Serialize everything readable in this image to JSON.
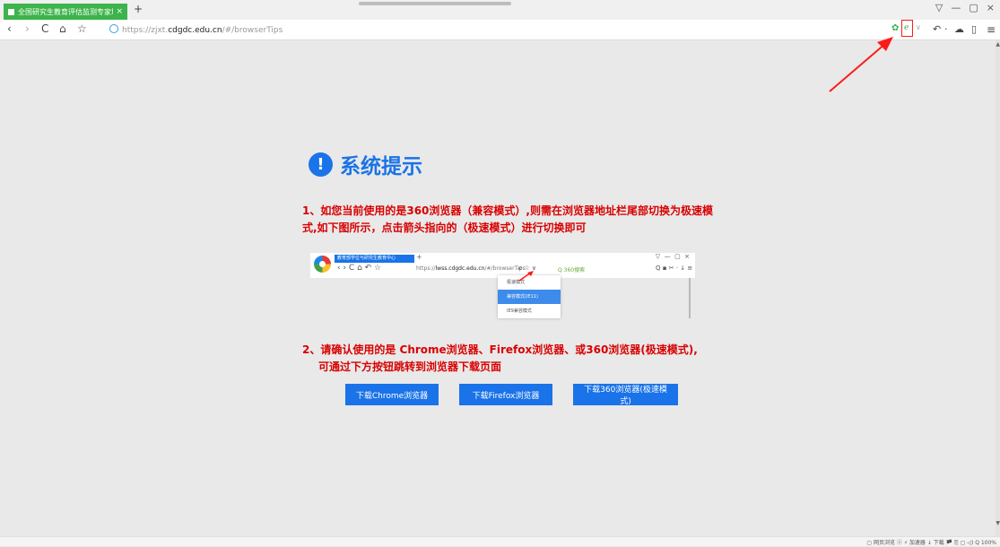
{
  "browser": {
    "tab_title": "全国研究生教育评估监测专家填!",
    "tab_close": "×",
    "new_tab": "+",
    "window_controls": [
      "▽",
      "—",
      "▢",
      "×"
    ],
    "nav": {
      "back": "‹",
      "forward": "›",
      "refresh": "C",
      "home": "⌂",
      "favorite": "☆"
    },
    "url_prefix": "https://zjxt.",
    "url_host": "cdgdc.edu.cn",
    "url_path": "/#/browserTips",
    "right_tools": [
      "↶",
      "·",
      "☁",
      "▯",
      "≡"
    ]
  },
  "page": {
    "heading_icon": "!",
    "heading": "系统提示",
    "tip1_line1": "1、如您当前使用的是360浏览器（兼容模式）,则需在浏览器地址栏尾部切换为极速模",
    "tip1_line2": "式,如下图所示，点击箭头指向的（极速模式）进行切换即可",
    "tip2_line1": "2、请确认使用的是 Chrome浏览器、Firefox浏览器、或360浏览器(极速模式),",
    "tip2_line2": "可通过下方按钮跳转到浏览器下载页面",
    "buttons": {
      "chrome": "下载Chrome浏览器",
      "firefox": "下载Firefox浏览器",
      "b360": "下载360浏览器(极速模式)"
    }
  },
  "illustration": {
    "tab_title": "教育部学位与研究生教育中心",
    "url_prefix": "https://",
    "url_host": "lwss.cdgdc.edu.cn",
    "url_path": "/#/browserTips",
    "search_text": "360搜索",
    "menu_items": [
      "极速模式",
      "兼容模式(IE11)",
      "IE9兼容模式"
    ]
  },
  "status_bar": {
    "text": "▢ 网页浏览   ⓩ   ⚡ 加速器   ↓ 下载   🏴   ⎘   ▢   ◁)   Q 100%"
  },
  "colors": {
    "accent": "#1a73e8",
    "warning_text": "#d90000",
    "tab_green": "#3cb44b",
    "highlight_red": "#ff1a1a"
  }
}
